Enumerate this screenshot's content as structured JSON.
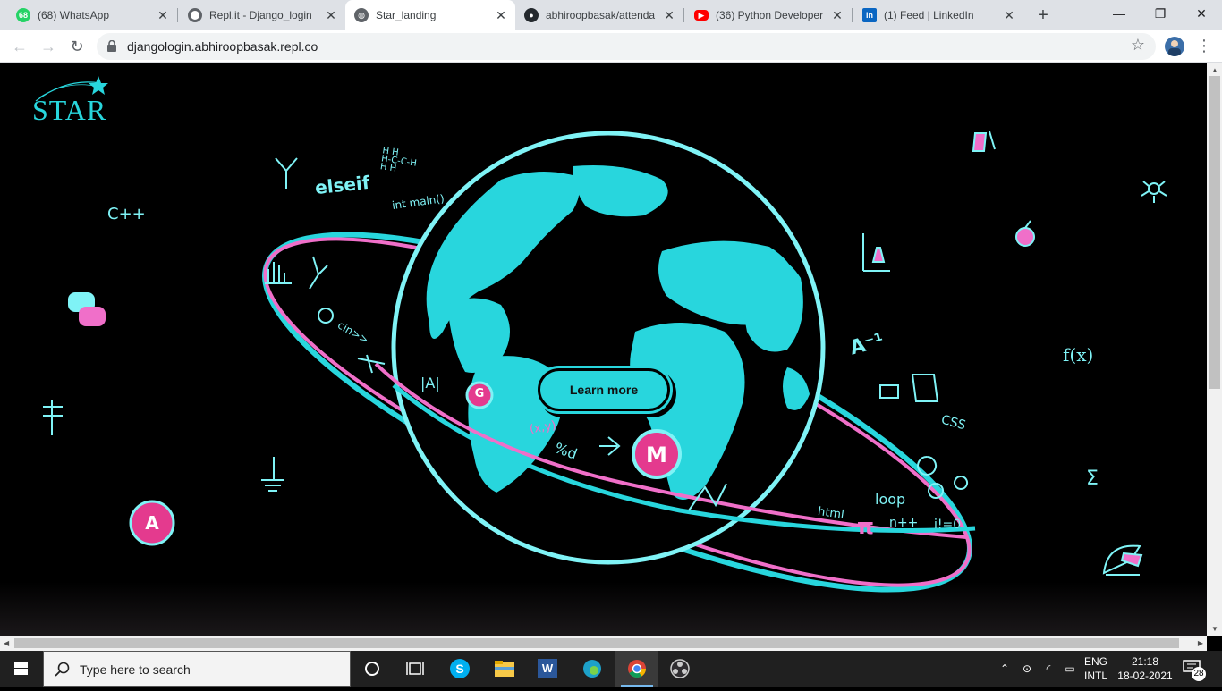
{
  "browser": {
    "tabs": [
      {
        "title": "(68) WhatsApp",
        "badge": "68",
        "icon": "whatsapp-icon",
        "active": false
      },
      {
        "title": "Repl.it - Django_login",
        "icon": "replit-icon",
        "active": false
      },
      {
        "title": "Star_landing",
        "icon": "globe-icon",
        "active": true
      },
      {
        "title": "abhiroopbasak/attenda",
        "icon": "github-icon",
        "active": false
      },
      {
        "title": "(36) Python Developer",
        "icon": "youtube-icon",
        "active": false
      },
      {
        "title": "(1) Feed | LinkedIn",
        "icon": "linkedin-icon",
        "active": false
      }
    ],
    "url": "djangologin.abhiroopbasak.repl.co"
  },
  "page": {
    "logo_text": "STAR",
    "cta_label": "Learn more",
    "doodles": {
      "cpp": "C++",
      "elseif": "elseif",
      "intmain": "int main()",
      "cin": "cin>>",
      "abs": "|A|",
      "fx": "f(x)",
      "sigma": "Σ",
      "css": "CSS",
      "loop": "loop",
      "nplus": "n++",
      "izero": "i!=0",
      "html": "html",
      "percent": "%d",
      "xsq": "(x,y)",
      "ainv": "A⁻¹",
      "pi": "π",
      "chem": "H H\nH-C-C-H\nH H",
      "badge_g": "G",
      "badge_m": "M",
      "badge_a": "A"
    },
    "colors": {
      "cyan": "#28d6dd",
      "pink": "#f06fc9",
      "magenta": "#e43a8e"
    }
  },
  "taskbar": {
    "search_placeholder": "Type here to search",
    "lang_line1": "ENG",
    "lang_line2": "INTL",
    "time": "21:18",
    "date": "18-02-2021",
    "notifications": "28"
  }
}
